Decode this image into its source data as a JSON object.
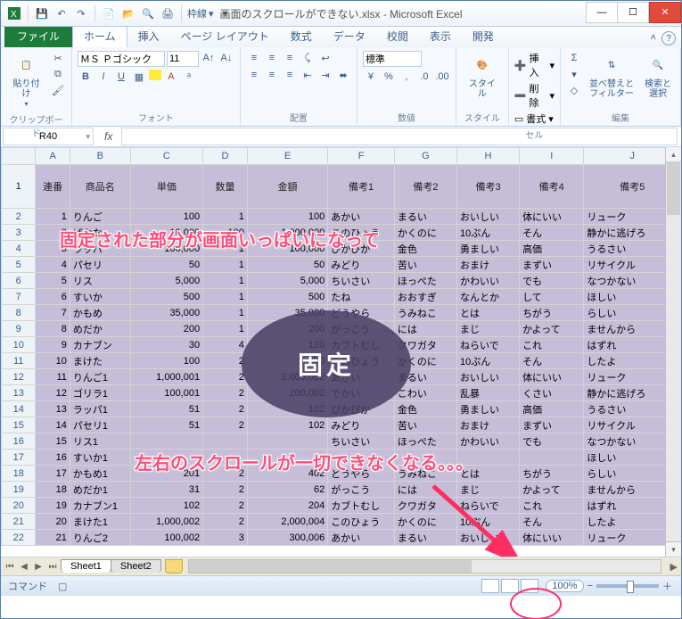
{
  "window": {
    "filename": "画面のスクロールができない.xlsx",
    "appname": "Microsoft Excel",
    "title": "画面のスクロールができない.xlsx - Microsoft Excel"
  },
  "qat": {
    "border_label": "枠線"
  },
  "ribbon": {
    "file": "ファイル",
    "tabs": [
      "ホーム",
      "挿入",
      "ページ レイアウト",
      "数式",
      "データ",
      "校閲",
      "表示",
      "開発"
    ],
    "active_tab": "ホーム",
    "groups": {
      "clipboard": {
        "label": "クリップボード",
        "paste": "貼り付け"
      },
      "font": {
        "label": "フォント",
        "name": "ＭＳ Ｐゴシック",
        "size": "11"
      },
      "alignment": {
        "label": "配置"
      },
      "number": {
        "label": "数値",
        "format": "標準"
      },
      "styles": {
        "label": "スタイル",
        "btn": "スタイル"
      },
      "cells": {
        "label": "セル",
        "insert": "挿入",
        "delete": "削除",
        "format": "書式"
      },
      "editing": {
        "label": "編集",
        "sort": "並べ替えと\nフィルター",
        "find": "検索と\n選択"
      }
    }
  },
  "namebox": "R40",
  "columns": [
    "",
    "A",
    "B",
    "C",
    "D",
    "E",
    "F",
    "G",
    "H",
    "I",
    "J"
  ],
  "hdr": [
    "",
    "連番",
    "商品名",
    "単価",
    "数量",
    "金額",
    "備考1",
    "備考2",
    "備考3",
    "備考4",
    "備考5"
  ],
  "rows": [
    {
      "n": 2,
      "c": [
        "1",
        "りんご",
        "100",
        "1",
        "100",
        "あかい",
        "まるい",
        "おいしい",
        "体にいい",
        "リューク"
      ]
    },
    {
      "n": 3,
      "c": [
        "2",
        "ばなな",
        "10,000",
        "100",
        "1,000,000",
        "このひょう",
        "かくのに",
        "10ぷん",
        "そん",
        "静かに逃げろ"
      ]
    },
    {
      "n": 4,
      "c": [
        "3",
        "ラッパ",
        "100,000",
        "1",
        "100,000",
        "ぴかぴか",
        "金色",
        "勇ましい",
        "高価",
        "うるさい"
      ]
    },
    {
      "n": 5,
      "c": [
        "4",
        "パセリ",
        "50",
        "1",
        "50",
        "みどり",
        "苦い",
        "おまけ",
        "まずい",
        "リサイクル"
      ]
    },
    {
      "n": 6,
      "c": [
        "5",
        "リス",
        "5,000",
        "1",
        "5,000",
        "ちいさい",
        "ほっぺた",
        "かわいい",
        "でも",
        "なつかない"
      ]
    },
    {
      "n": 7,
      "c": [
        "6",
        "すいか",
        "500",
        "1",
        "500",
        "たね",
        "おおすぎ",
        "なんとか",
        "して",
        "ほしい"
      ]
    },
    {
      "n": 8,
      "c": [
        "7",
        "かもめ",
        "35,000",
        "1",
        "35,000",
        "どうやら",
        "うみねこ",
        "とは",
        "ちがう",
        "らしい"
      ]
    },
    {
      "n": 9,
      "c": [
        "8",
        "めだか",
        "200",
        "1",
        "200",
        "がっこう",
        "には",
        "まじ",
        "かよって",
        "ませんから"
      ]
    },
    {
      "n": 10,
      "c": [
        "9",
        "カナブン",
        "30",
        "4",
        "120",
        "カブトむし",
        "クワガタ",
        "ねらいで",
        "これ",
        "はずれ"
      ]
    },
    {
      "n": 11,
      "c": [
        "10",
        "まけた",
        "100",
        "2",
        "200",
        "このひょう",
        "かくのに",
        "10ぷん",
        "そん",
        "したよ"
      ]
    },
    {
      "n": 12,
      "c": [
        "11",
        "りんご1",
        "1,000,001",
        "2",
        "2,000,002",
        "あかい",
        "まるい",
        "おいしい",
        "体にいい",
        "リューク"
      ]
    },
    {
      "n": 13,
      "c": [
        "12",
        "ゴリラ1",
        "100,001",
        "2",
        "200,002",
        "でかい",
        "こわい",
        "乱暴",
        "くさい",
        "静かに逃げろ"
      ]
    },
    {
      "n": 14,
      "c": [
        "13",
        "ラッパ1",
        "51",
        "2",
        "102",
        "ぴかぴか",
        "金色",
        "勇ましい",
        "高価",
        "うるさい"
      ]
    },
    {
      "n": 15,
      "c": [
        "14",
        "パセリ1",
        "51",
        "2",
        "102",
        "みどり",
        "苦い",
        "おまけ",
        "まずい",
        "リサイクル"
      ]
    },
    {
      "n": 16,
      "c": [
        "15",
        "リス1",
        "",
        "",
        "",
        "ちいさい",
        "ほっぺた",
        "かわいい",
        "でも",
        "なつかない"
      ]
    },
    {
      "n": 17,
      "c": [
        "16",
        "すいか1",
        "",
        "",
        "",
        "",
        "",
        "",
        "",
        "ほしい"
      ]
    },
    {
      "n": 18,
      "c": [
        "17",
        "かもめ1",
        "201",
        "2",
        "402",
        "どうやら",
        "うみねこ",
        "とは",
        "ちがう",
        "らしい"
      ]
    },
    {
      "n": 19,
      "c": [
        "18",
        "めだか1",
        "31",
        "2",
        "62",
        "がっこう",
        "には",
        "まじ",
        "かよって",
        "ませんから"
      ]
    },
    {
      "n": 20,
      "c": [
        "19",
        "カナブン1",
        "102",
        "2",
        "204",
        "カブトむし",
        "クワガタ",
        "ねらいで",
        "これ",
        "はずれ"
      ]
    },
    {
      "n": 21,
      "c": [
        "20",
        "まけた1",
        "1,000,002",
        "2",
        "2,000,004",
        "このひょう",
        "かくのに",
        "10ぷん",
        "そん",
        "したよ"
      ]
    },
    {
      "n": 22,
      "c": [
        "21",
        "りんご2",
        "100,002",
        "3",
        "300,006",
        "あかい",
        "まるい",
        "おいしい",
        "体にいい",
        "リューク"
      ]
    }
  ],
  "numeric_cols": [
    0,
    2,
    3,
    4
  ],
  "sheets": [
    "Sheet1",
    "Sheet2"
  ],
  "active_sheet": "Sheet1",
  "status": {
    "mode": "コマンド",
    "zoom": "100%",
    "minus": "−",
    "plus": "＋"
  },
  "annotations": {
    "top": "固定された部分が画面いっぱいになって",
    "center": "固定",
    "bottom": "左右のスクロールが一切できなくなる。。。"
  }
}
